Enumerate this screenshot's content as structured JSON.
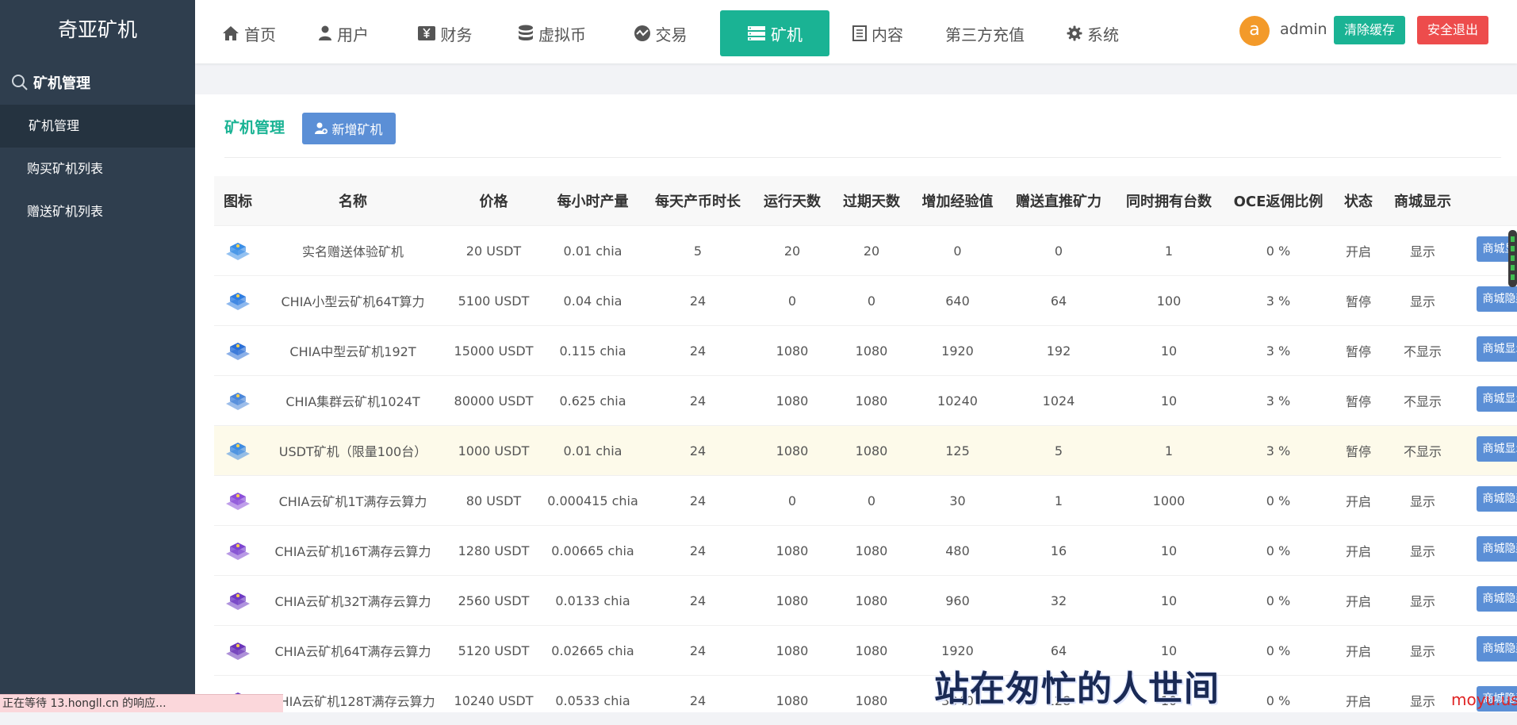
{
  "sidebar": {
    "brand": "奇亚矿机",
    "section": "矿机管理",
    "items": [
      {
        "label": "矿机管理"
      },
      {
        "label": "购买矿机列表"
      },
      {
        "label": "赠送矿机列表"
      }
    ]
  },
  "topnav": {
    "items": [
      {
        "label": "首页",
        "icon": "home-icon"
      },
      {
        "label": "用户",
        "icon": "user-icon"
      },
      {
        "label": "财务",
        "icon": "yen-icon"
      },
      {
        "label": "虚拟币",
        "icon": "database-icon"
      },
      {
        "label": "交易",
        "icon": "trade-icon"
      },
      {
        "label": "矿机",
        "icon": "server-icon",
        "active": true
      },
      {
        "label": "内容",
        "icon": "document-icon"
      },
      {
        "label": "第三方充值"
      },
      {
        "label": "系统",
        "icon": "gear-icon"
      }
    ],
    "avatar_letter": "a",
    "username": "admin",
    "clear_cache": "清除缓存",
    "logout": "安全退出"
  },
  "page": {
    "title": "矿机管理",
    "add_button": "新增矿机"
  },
  "table": {
    "headers": [
      "图标",
      "名称",
      "价格",
      "每小时产量",
      "每天产币时长",
      "运行天数",
      "过期天数",
      "增加经验值",
      "赠送直推矿力",
      "同时拥有台数",
      "OCE返佣比例",
      "状态",
      "商城显示"
    ],
    "rows": [
      {
        "name": "实名赠送体验矿机",
        "price": "20 USDT",
        "hourly": "0.01 chia",
        "hours": "5",
        "run_days": "20",
        "expire_days": "20",
        "exp": "0",
        "power": "0",
        "max_own": "1",
        "ratio": "0 %",
        "status": "开启",
        "shop": "显示",
        "action": "商城显示"
      },
      {
        "name": "CHIA小型云矿机64T算力",
        "price": "5100 USDT",
        "hourly": "0.04 chia",
        "hours": "24",
        "run_days": "0",
        "expire_days": "0",
        "exp": "640",
        "power": "64",
        "max_own": "100",
        "ratio": "3 %",
        "status": "暂停",
        "shop": "显示",
        "action": "商城隐藏"
      },
      {
        "name": "CHIA中型云矿机192T",
        "price": "15000 USDT",
        "hourly": "0.115 chia",
        "hours": "24",
        "run_days": "1080",
        "expire_days": "1080",
        "exp": "1920",
        "power": "192",
        "max_own": "10",
        "ratio": "3 %",
        "status": "暂停",
        "shop": "不显示",
        "action": "商城显示"
      },
      {
        "name": "CHIA集群云矿机1024T",
        "price": "80000 USDT",
        "hourly": "0.625 chia",
        "hours": "24",
        "run_days": "1080",
        "expire_days": "1080",
        "exp": "10240",
        "power": "1024",
        "max_own": "10",
        "ratio": "3 %",
        "status": "暂停",
        "shop": "不显示",
        "action": "商城显示"
      },
      {
        "name": "USDT矿机（限量100台）",
        "price": "1000 USDT",
        "hourly": "0.01 chia",
        "hours": "24",
        "run_days": "1080",
        "expire_days": "1080",
        "exp": "125",
        "power": "5",
        "max_own": "1",
        "ratio": "3 %",
        "status": "暂停",
        "shop": "不显示",
        "action": "商城显示",
        "highlight": true
      },
      {
        "name": "CHIA云矿机1T满存云算力",
        "price": "80 USDT",
        "hourly": "0.000415 chia",
        "hours": "24",
        "run_days": "0",
        "expire_days": "0",
        "exp": "30",
        "power": "1",
        "max_own": "1000",
        "ratio": "0 %",
        "status": "开启",
        "shop": "显示",
        "action": "商城隐藏"
      },
      {
        "name": "CHIA云矿机16T满存云算力",
        "price": "1280 USDT",
        "hourly": "0.00665 chia",
        "hours": "24",
        "run_days": "1080",
        "expire_days": "1080",
        "exp": "480",
        "power": "16",
        "max_own": "10",
        "ratio": "0 %",
        "status": "开启",
        "shop": "显示",
        "action": "商城隐藏"
      },
      {
        "name": "CHIA云矿机32T满存云算力",
        "price": "2560 USDT",
        "hourly": "0.0133 chia",
        "hours": "24",
        "run_days": "1080",
        "expire_days": "1080",
        "exp": "960",
        "power": "32",
        "max_own": "10",
        "ratio": "0 %",
        "status": "开启",
        "shop": "显示",
        "action": "商城隐藏"
      },
      {
        "name": "CHIA云矿机64T满存云算力",
        "price": "5120 USDT",
        "hourly": "0.02665 chia",
        "hours": "24",
        "run_days": "1080",
        "expire_days": "1080",
        "exp": "1920",
        "power": "64",
        "max_own": "10",
        "ratio": "0 %",
        "status": "开启",
        "shop": "显示",
        "action": "商城隐藏"
      },
      {
        "name": "CHIA云矿机128T满存云算力",
        "price": "10240 USDT",
        "hourly": "0.0533 chia",
        "hours": "24",
        "run_days": "1080",
        "expire_days": "1080",
        "exp": "3840",
        "power": "128",
        "max_own": "10",
        "ratio": "0 %",
        "status": "开启",
        "shop": "显示",
        "action": "商城隐藏"
      }
    ]
  },
  "icon_colors": [
    "#3a8ee6",
    "#2f7de0",
    "#2b6fd6",
    "#4a86d9",
    "#3f8be0",
    "#8b4fd8",
    "#7d45cf",
    "#6e3ac2",
    "#6a34b8",
    "#6f3bc4"
  ],
  "statusbar": "正在等待 13.hongll.cn 的响应...",
  "subtitle": "站在匆忙的人世间",
  "watermark": "moyu.us",
  "colors": {
    "accent": "#1ab394",
    "sidebar": "#2f3e4e",
    "danger": "#ed4c4c",
    "primary": "#5b8fd6"
  }
}
